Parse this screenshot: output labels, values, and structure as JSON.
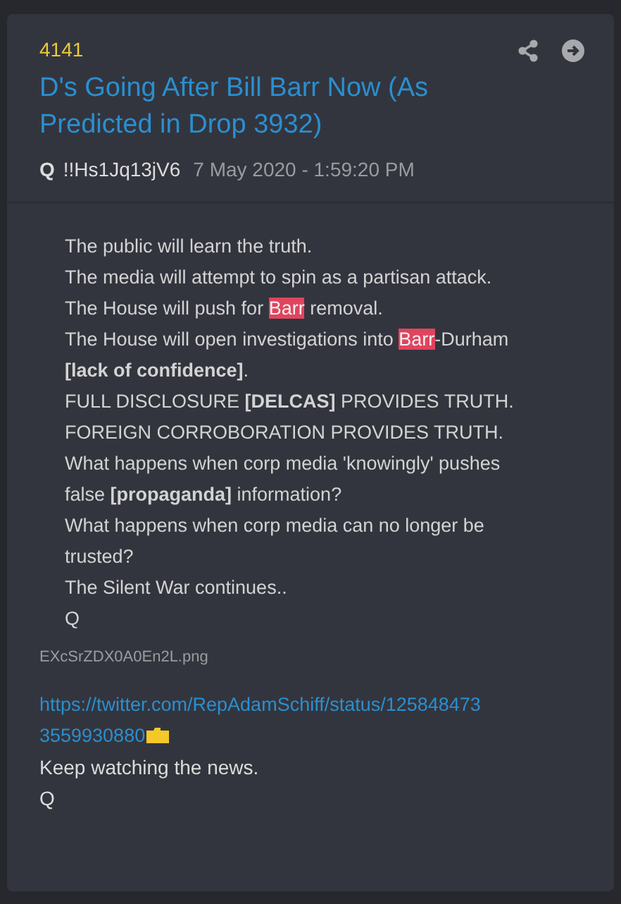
{
  "post": {
    "number": "4141",
    "title": "D's Going After Bill Barr Now (As Predicted in Drop 3932)",
    "author": "Q",
    "tripcode": "!!Hs1Jq13jV6",
    "timestamp": "7 May 2020 - 1:59:20 PM"
  },
  "image": {
    "lines": [
      {
        "segments": [
          {
            "text": "The public will learn the truth.",
            "highlighted": false
          }
        ]
      },
      {
        "segments": [
          {
            "text": "The media will attempt to spin as a partisan attack.",
            "highlighted": false
          }
        ]
      },
      {
        "segments": [
          {
            "text": "The House will push for ",
            "highlighted": false
          },
          {
            "text": "Barr",
            "highlighted": true
          },
          {
            "text": " removal.",
            "highlighted": false
          }
        ]
      },
      {
        "segments": [
          {
            "text": "The House will open investigations into ",
            "highlighted": false
          },
          {
            "text": "Barr",
            "highlighted": true
          },
          {
            "text": "-Durham",
            "highlighted": false
          }
        ]
      },
      {
        "segments": [
          {
            "text": "**[lack of confidence]**.",
            "highlighted": false
          }
        ]
      },
      {
        "segments": [
          {
            "text": "FULL DISCLOSURE **[DELCAS]** PROVIDES TRUTH.",
            "highlighted": false
          }
        ]
      },
      {
        "segments": [
          {
            "text": "FOREIGN CORROBORATION PROVIDES TRUTH.",
            "highlighted": false
          }
        ]
      },
      {
        "segments": [
          {
            "text": "What happens when corp media 'knowingly' pushes",
            "highlighted": false
          }
        ]
      },
      {
        "segments": [
          {
            "text": "false **[propaganda]** information?",
            "highlighted": false
          }
        ]
      },
      {
        "segments": [
          {
            "text": "What happens when corp media can no longer be",
            "highlighted": false
          }
        ]
      },
      {
        "segments": [
          {
            "text": "trusted?",
            "highlighted": false
          }
        ]
      },
      {
        "segments": [
          {
            "text": "The Silent War continues..",
            "highlighted": false
          }
        ]
      },
      {
        "segments": [
          {
            "text": "Q",
            "highlighted": false
          }
        ]
      }
    ],
    "filename": "EXcSrZDX0A0En2L.png"
  },
  "body": {
    "link_lines": [
      "https://twitter.com/RepAdamSchiff/status/125848473",
      "3559930880"
    ],
    "lines": [
      "Keep watching the news.",
      "Q"
    ]
  }
}
